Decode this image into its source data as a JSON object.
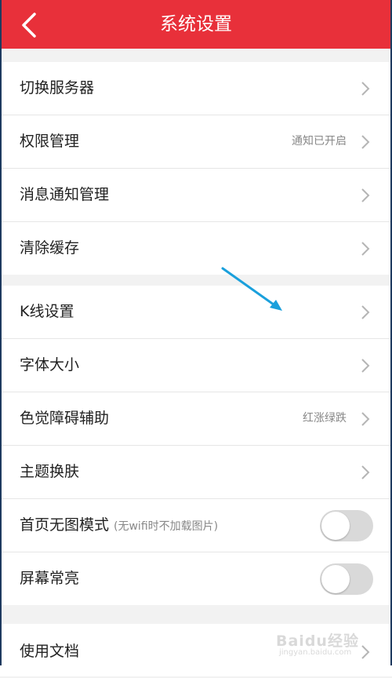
{
  "header": {
    "title": "系统设置",
    "back_icon": "chevron-left-icon",
    "background": "#e8303a"
  },
  "groups": [
    {
      "items": [
        {
          "label": "切换服务器",
          "value": "",
          "type": "link"
        },
        {
          "label": "权限管理",
          "value": "通知已开启",
          "type": "link"
        },
        {
          "label": "消息通知管理",
          "value": "",
          "type": "link"
        },
        {
          "label": "清除缓存",
          "value": "",
          "type": "link"
        }
      ]
    },
    {
      "items": [
        {
          "label": "K线设置",
          "value": "",
          "type": "link"
        },
        {
          "label": "字体大小",
          "value": "",
          "type": "link"
        },
        {
          "label": "色觉障碍辅助",
          "value": "红涨绿跌",
          "type": "link"
        },
        {
          "label": "主题换肤",
          "value": "",
          "type": "link"
        },
        {
          "label": "首页无图模式",
          "note": "(无wifi时不加载图片)",
          "type": "toggle",
          "on": false
        },
        {
          "label": "屏幕常亮",
          "type": "toggle",
          "on": false
        }
      ]
    },
    {
      "items": [
        {
          "label": "使用文档",
          "value": "",
          "type": "link"
        }
      ]
    }
  ],
  "annotation": {
    "icon": "arrow-annotation-icon",
    "color": "#1aa0dc"
  },
  "watermark": {
    "logo": "Baidu经验",
    "url": "jingyan.baidu.com"
  }
}
